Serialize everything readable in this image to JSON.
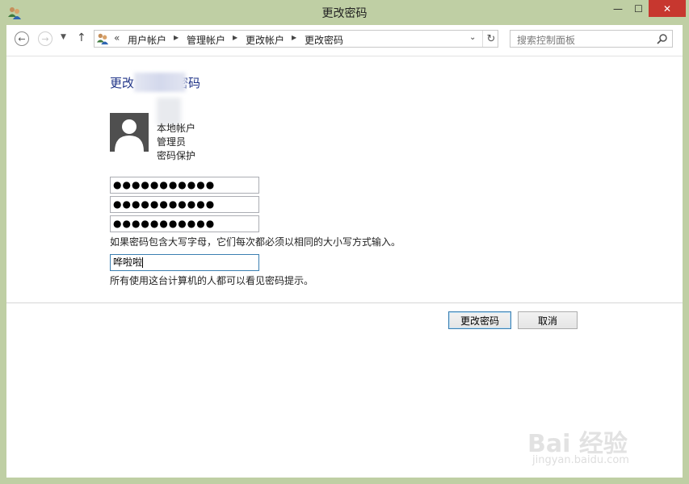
{
  "window": {
    "title": "更改密码",
    "buttons": {
      "minimize": "—",
      "maximize": "☐",
      "close": "✕"
    }
  },
  "nav": {
    "back_icon": "←",
    "forward_icon": "→",
    "recent_icon": "▼",
    "up_icon": "↑",
    "address_chevron": "«",
    "breadcrumbs": [
      "用户帐户",
      "管理帐户",
      "更改帐户",
      "更改密码"
    ],
    "breadcrumb_separator": "▶",
    "dropdown_icon": "⌄",
    "refresh_icon": "↻",
    "search_placeholder": "搜索控制面板"
  },
  "page": {
    "heading_prefix": "更改",
    "heading_suffix": "密码",
    "account": {
      "type": "本地帐户",
      "role": "管理员",
      "status": "密码保护"
    },
    "password_fields": [
      "●●●●●●●●●●●",
      "●●●●●●●●●●●",
      "●●●●●●●●●●●"
    ],
    "case_note": "如果密码包含大写字母，它们每次都必须以相同的大小写方式输入。",
    "hint_value": "哗啦啦",
    "hint_note": "所有使用这台计算机的人都可以看见密码提示。",
    "change_button": "更改密码",
    "cancel_button": "取消"
  },
  "watermark": {
    "main": "Bai 经验",
    "sub": "jingyan.baidu.com"
  },
  "colors": {
    "frame": "#bfcfa4",
    "heading": "#1e3287",
    "close": "#c7372f",
    "focus": "#3c7fb1"
  },
  "icons": [
    "users-icon",
    "back-icon",
    "forward-icon",
    "up-icon",
    "refresh-icon",
    "search-icon",
    "user-avatar-icon"
  ]
}
